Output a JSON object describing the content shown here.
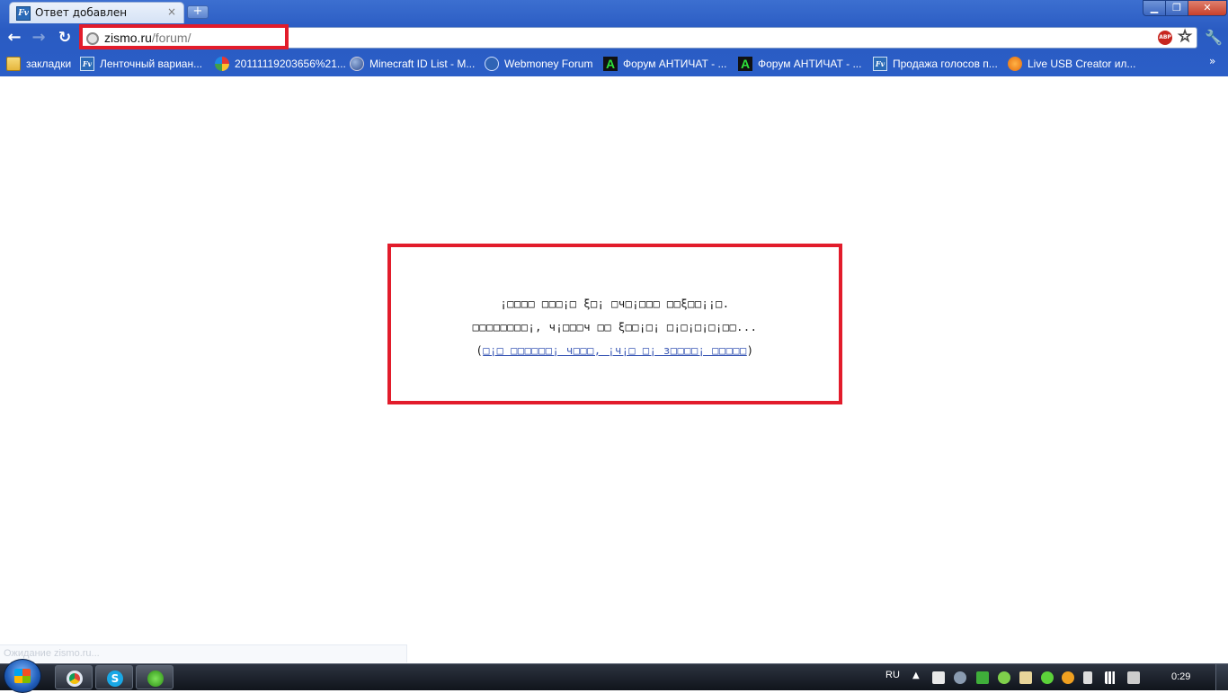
{
  "tab": {
    "title": "Ответ добавлен",
    "close": "×",
    "favicon": "Fv"
  },
  "window": {
    "minimize": "▁",
    "maximize": "❐",
    "close": "✕",
    "new_tab": "+"
  },
  "toolbar": {
    "back": "←",
    "forward": "→",
    "reload": "↻"
  },
  "omnibox": {
    "host": "zismo.ru",
    "path": "/forum/",
    "abp": "ABP",
    "star": "☆",
    "wrench": "🔧"
  },
  "bookmarks": {
    "items": [
      {
        "label": "закладки",
        "icon": "folder-icon"
      },
      {
        "label": "Ленточный вариан...",
        "icon": "fv-icon"
      },
      {
        "label": "20111119203656%21...",
        "icon": "picasa-icon"
      },
      {
        "label": "Minecraft ID List - M...",
        "icon": "globe-icon"
      },
      {
        "label": "Webmoney Forum",
        "icon": "webmoney-icon"
      },
      {
        "label": "Форум АНТИЧАТ - ...",
        "icon": "antichat-icon"
      },
      {
        "label": "Форум АНТИЧАТ - ...",
        "icon": "antichat-icon"
      },
      {
        "label": "Продажа голосов п...",
        "icon": "fv-icon"
      },
      {
        "label": "Live USB Creator ил...",
        "icon": "usb-icon"
      }
    ],
    "more": "»"
  },
  "page": {
    "line1": "¡□□□□ □□□¡□ ξ□¡ □ч□¡□□□ □□ξ□□¡¡□.",
    "line2": "□□□□□□□□¡, ч¡□□□ч □□ ξ□□¡□¡ □¡□¡□¡□¡□□...",
    "line3_open": "(",
    "line3_link": "□¡□ □□□□□□¡ ч□□□, ¡ч¡□ □¡ з□□□□¡ □□□□□",
    "line3_close": ")"
  },
  "status": {
    "text": "Ожидание zismo.ru..."
  },
  "taskbar": {
    "lang": "RU",
    "tray_arrow": "▲",
    "clock": "0:29",
    "skype": "S"
  }
}
